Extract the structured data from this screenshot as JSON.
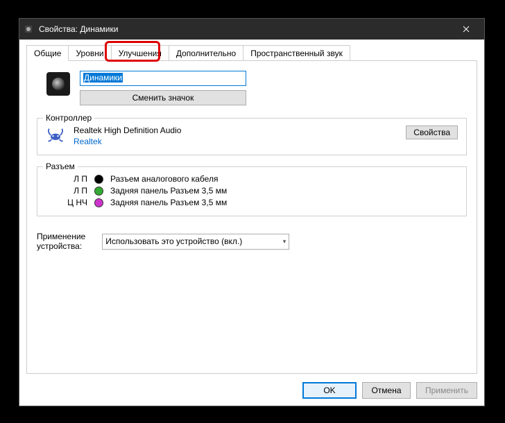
{
  "window": {
    "title": "Свойства: Динамики"
  },
  "tabs": {
    "general": "Общие",
    "levels": "Уровни",
    "enhance": "Улучшения",
    "advanced": "Дополнительно",
    "spatial": "Пространственный звук"
  },
  "device": {
    "name": "Динамики",
    "change_icon": "Сменить значок"
  },
  "controller": {
    "legend": "Контроллер",
    "name": "Realtek High Definition Audio",
    "vendor": "Realtek",
    "props_btn": "Свойства"
  },
  "jacks": {
    "legend": "Разъем",
    "items": [
      {
        "lbl": "Л П",
        "color": "black",
        "desc": "Разъем аналогового кабеля"
      },
      {
        "lbl": "Л П",
        "color": "green",
        "desc": "Задняя панель Разъем 3,5 мм"
      },
      {
        "lbl": "Ц НЧ",
        "color": "magenta",
        "desc": "Задняя панель Разъем 3,5 мм"
      }
    ]
  },
  "usage": {
    "label1": "Применение",
    "label2": "устройства:",
    "selected": "Использовать это устройство (вкл.)"
  },
  "buttons": {
    "ok": "OK",
    "cancel": "Отмена",
    "apply": "Применить"
  }
}
